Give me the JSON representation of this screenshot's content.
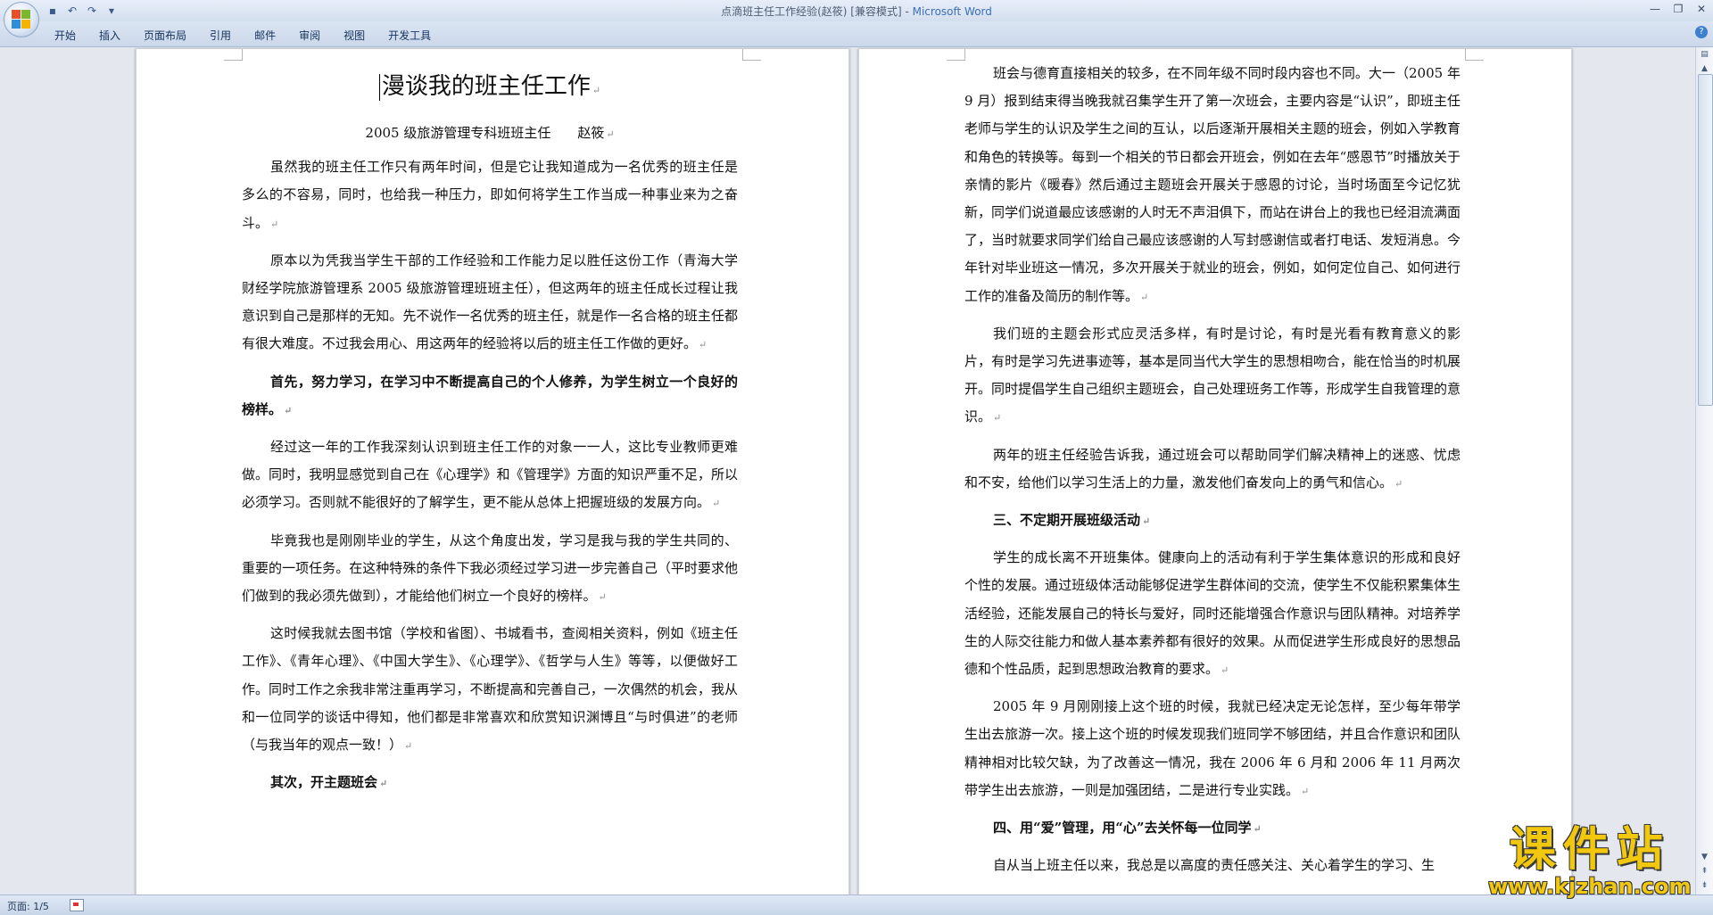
{
  "window": {
    "title": "点滴班主任工作经验(赵筱) [兼容模式]",
    "title_separator": " - ",
    "app_name": "Microsoft Word"
  },
  "ribbon_tabs": [
    "开始",
    "插入",
    "页面布局",
    "引用",
    "邮件",
    "审阅",
    "视图",
    "开发工具"
  ],
  "status": {
    "page": "页面: 1/5"
  },
  "watermark": {
    "cn": "课件站",
    "url": "www.kjzhan.com"
  },
  "page1": {
    "title": "漫谈我的班主任工作",
    "subtitle": "2005 级旅游管理专科班班主任　　赵筱",
    "paras": [
      "虽然我的班主任工作只有两年时间，但是它让我知道成为一名优秀的班主任是多么的不容易，同时，也给我一种压力，即如何将学生工作当成一种事业来为之奋斗。",
      "原本以为凭我当学生干部的工作经验和工作能力足以胜任这份工作（青海大学财经学院旅游管理系 2005 级旅游管理班班主任），但这两年的班主任成长过程让我意识到自己是那样的无知。先不说作一名优秀的班主任，就是作一名合格的班主任都有很大难度。不过我会用心、用这两年的经验将以后的班主任工作做的更好。",
      "首先，努力学习，在学习中不断提高自己的个人修养，为学生树立一个良好的榜样。",
      "经过这一年的工作我深刻认识到班主任工作的对象一一人，这比专业教师更难做。同时，我明显感觉到自己在《心理学》和《管理学》方面的知识严重不足，所以必须学习。否则就不能很好的了解学生，更不能从总体上把握班级的发展方向。",
      "毕竟我也是刚刚毕业的学生，从这个角度出发，学习是我与我的学生共同的、重要的一项任务。在这种特殊的条件下我必须经过学习进一步完善自己（平时要求他们做到的我必须先做到），才能给他们树立一个良好的榜样。",
      "这时候我就去图书馆（学校和省图）、书城看书，查阅相关资料，例如《班主任工作》、《青年心理》、《中国大学生》、《心理学》、《哲学与人生》等等，以便做好工作。同时工作之余我非常注重再学习，不断提高和完善自己，一次偶然的机会，我从和一位同学的谈话中得知，他们都是非常喜欢和欣赏知识渊博且“与时俱进”的老师（与我当年的观点一致！）",
      "其次，开主题班会"
    ]
  },
  "page2": {
    "paras": [
      "班会与德育直接相关的较多，在不同年级不同时段内容也不同。大一（2005 年 9 月）报到结束得当晚我就召集学生开了第一次班会，主要内容是“认识”，即班主任老师与学生的认识及学生之间的互认，以后逐渐开展相关主题的班会，例如入学教育和角色的转换等。每到一个相关的节日都会开班会，例如在去年“感恩节”时播放关于亲情的影片《暖春》然后通过主题班会开展关于感恩的讨论，当时场面至今记忆犹新，同学们说道最应该感谢的人时无不声泪俱下，而站在讲台上的我也已经泪流满面了，当时就要求同学们给自己最应该感谢的人写封感谢信或者打电话、发短消息。今年针对毕业班这一情况，多次开展关于就业的班会，例如，如何定位自己、如何进行工作的准备及简历的制作等。",
      "我们班的主题会形式应灵活多样，有时是讨论，有时是光看有教育意义的影片，有时是学习先进事迹等，基本是同当代大学生的思想相吻合，能在恰当的时机展开。同时提倡学生自己组织主题班会，自己处理班务工作等，形成学生自我管理的意识。",
      "两年的班主任经验告诉我，通过班会可以帮助同学们解决精神上的迷惑、忧虑和不安，给他们以学习生活上的力量，激发他们奋发向上的勇气和信心。",
      "三、不定期开展班级活动",
      "学生的成长离不开班集体。健康向上的活动有利于学生集体意识的形成和良好个性的发展。通过班级体活动能够促进学生群体间的交流，使学生不仅能积累集体生活经验，还能发展自己的特长与爱好，同时还能增强合作意识与团队精神。对培养学生的人际交往能力和做人基本素养都有很好的效果。从而促进学生形成良好的思想品德和个性品质，起到思想政治教育的要求。",
      "2005 年 9 月刚刚接上这个班的时候，我就已经决定无论怎样，至少每年带学生出去旅游一次。接上这个班的时候发现我们班同学不够团结，并且合作意识和团队精神相对比较欠缺，为了改善这一情况，我在 2006 年 6 月和 2006 年 11 月两次带学生出去旅游，一则是加强团结，二是进行专业实践。",
      "四、用“爱”管理，用“心”去关怀每一位同学",
      "自从当上班主任以来，我总是以高度的责任感关注、关心着学生的学习、生"
    ]
  }
}
